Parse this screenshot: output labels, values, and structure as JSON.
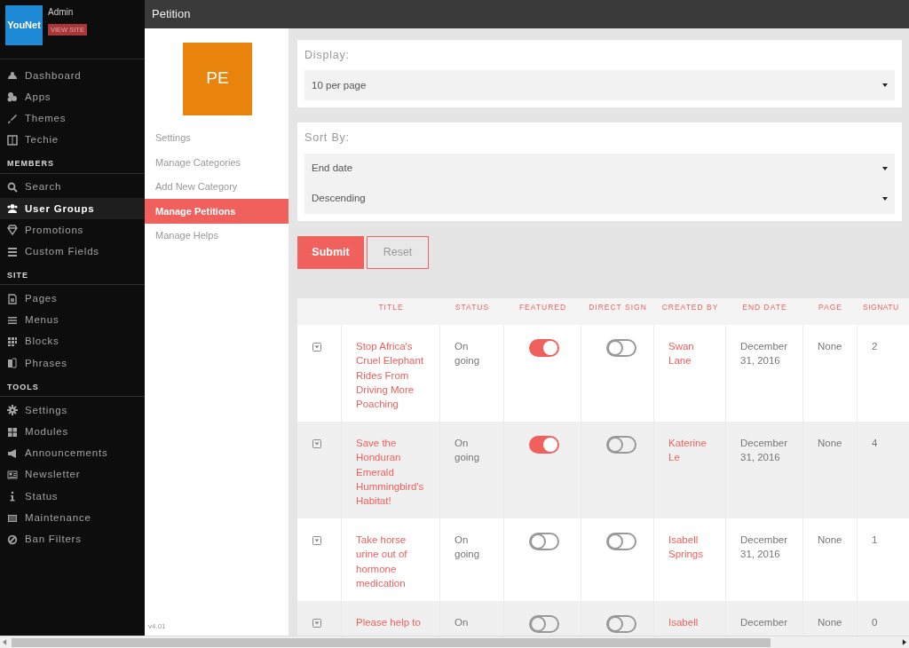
{
  "sidebar": {
    "logo_text": "YouNet",
    "user": "Admin",
    "view_site": "VIEW SITE",
    "sections": [
      {
        "items": [
          {
            "label": "Dashboard",
            "selected": false
          },
          {
            "label": "Apps",
            "selected": false
          },
          {
            "label": "Themes",
            "selected": false
          },
          {
            "label": "Techie",
            "selected": false
          }
        ]
      },
      {
        "heading": "MEMBERS",
        "items": [
          {
            "label": "Search",
            "selected": false
          },
          {
            "label": "User Groups",
            "selected": true
          },
          {
            "label": "Promotions",
            "selected": false
          },
          {
            "label": "Custom Fields",
            "selected": false
          }
        ]
      },
      {
        "heading": "SITE",
        "items": [
          {
            "label": "Pages",
            "selected": false
          },
          {
            "label": "Menus",
            "selected": false
          },
          {
            "label": "Blocks",
            "selected": false
          },
          {
            "label": "Phrases",
            "selected": false
          }
        ]
      },
      {
        "heading": "TOOLS",
        "items": [
          {
            "label": "Settings",
            "selected": false
          },
          {
            "label": "Modules",
            "selected": false
          },
          {
            "label": "Announcements",
            "selected": false
          },
          {
            "label": "Newsletter",
            "selected": false
          },
          {
            "label": "Status",
            "selected": false
          },
          {
            "label": "Maintenance",
            "selected": false
          },
          {
            "label": "Ban Filters",
            "selected": false
          }
        ]
      }
    ]
  },
  "header": {
    "title": "Petition"
  },
  "subnav": {
    "avatar": "PE",
    "items": [
      {
        "label": "Settings",
        "selected": false
      },
      {
        "label": "Manage Categories",
        "selected": false
      },
      {
        "label": "Add New Category",
        "selected": false
      },
      {
        "label": "Manage Petitions",
        "selected": true
      },
      {
        "label": "Manage Helps",
        "selected": false
      }
    ],
    "version": "v4.01"
  },
  "display": {
    "label": "Display:",
    "value": "10 per page"
  },
  "sort": {
    "label": "Sort By:",
    "values": [
      "End date",
      "Descending"
    ]
  },
  "buttons": [
    {
      "label": "Submit",
      "kind": "primary"
    },
    {
      "label": "Reset",
      "kind": "outline"
    }
  ],
  "table": {
    "columns": [
      "TITLE",
      "STATUS",
      "FEATURED",
      "DIRECT SIGN",
      "CREATED BY",
      "END DATE",
      "PAGE",
      "SIGNATU"
    ],
    "rows": [
      {
        "title": "Stop Africa's Cruel Elephant Rides From Driving More Poaching",
        "status": "On going",
        "featured": true,
        "direct_sign": false,
        "created_by": "Swan Lane",
        "end_date": "December 31, 2016",
        "page": "None",
        "signatures": "2"
      },
      {
        "title": "Save the Honduran Emerald Hummingbird's Habitat!",
        "status": "On going",
        "featured": true,
        "direct_sign": false,
        "created_by": "Katerine Le",
        "end_date": "December 31, 2016",
        "page": "None",
        "signatures": "4"
      },
      {
        "title": "Take horse urine out of hormone medication",
        "status": "On going",
        "featured": false,
        "direct_sign": false,
        "created_by": "Isabell Springs",
        "end_date": "December 31, 2016",
        "page": "None",
        "signatures": "1"
      },
      {
        "title": "Please help to",
        "status": "On",
        "featured": false,
        "direct_sign": false,
        "created_by": "Isabell",
        "end_date": "December",
        "page": "None",
        "signatures": "0"
      }
    ]
  }
}
